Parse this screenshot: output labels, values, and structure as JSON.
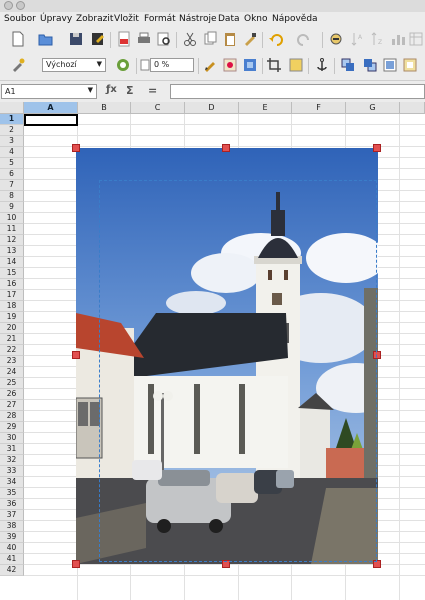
{
  "menu": {
    "items": [
      {
        "label": "Soubor"
      },
      {
        "label": "Úpravy"
      },
      {
        "label": "Zobrazit"
      },
      {
        "label": "Vložit"
      },
      {
        "label": "Formát"
      },
      {
        "label": "Nástroje"
      },
      {
        "label": "Data"
      },
      {
        "label": "Okno"
      },
      {
        "label": "Nápověda"
      }
    ]
  },
  "toolbar2": {
    "paragraph_style": "Výchozí",
    "percent_value": "0 %"
  },
  "formula_bar": {
    "cell_reference": "A1",
    "formula_value": ""
  },
  "sheet": {
    "columns": [
      "A",
      "B",
      "C",
      "D",
      "E",
      "F",
      "G"
    ],
    "selected_column": "A",
    "selected_row": "1",
    "rows": [
      "1",
      "2",
      "3",
      "4",
      "5",
      "6",
      "7",
      "8",
      "9",
      "10",
      "11",
      "12",
      "13",
      "14",
      "15",
      "16",
      "17",
      "18",
      "19",
      "20",
      "21",
      "22",
      "23",
      "24",
      "25",
      "26",
      "27",
      "28",
      "29",
      "30",
      "31",
      "32",
      "33",
      "34",
      "35",
      "36",
      "37",
      "38",
      "39",
      "40",
      "41",
      "42"
    ]
  },
  "image": {
    "subject": "church-photo",
    "selected": true
  },
  "colors": {
    "selection_header": "#9fc3ea",
    "handle": "#e25050",
    "crop_border": "#3a7dc9"
  }
}
